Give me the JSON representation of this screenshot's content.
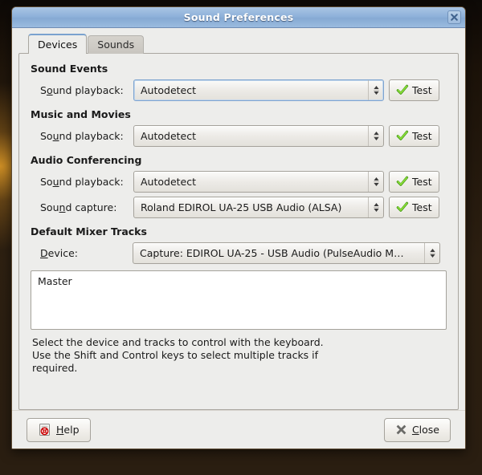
{
  "window": {
    "title": "Sound Preferences",
    "close_icon": "close-icon"
  },
  "tabs": [
    {
      "label": "Devices",
      "active": true
    },
    {
      "label": "Sounds",
      "active": false
    }
  ],
  "groups": [
    {
      "title": "Sound Events",
      "rows": [
        {
          "label_before": "S",
          "label_mnemonic": "o",
          "label_after": "und playback:",
          "value": "Autodetect",
          "button": "Test",
          "button_icon": "check-icon",
          "focused": true
        }
      ]
    },
    {
      "title": "Music and Movies",
      "rows": [
        {
          "label_before": "So",
          "label_mnemonic": "u",
          "label_after": "nd playback:",
          "value": "Autodetect",
          "button": "Test",
          "button_icon": "check-icon",
          "focused": false
        }
      ]
    },
    {
      "title": "Audio Conferencing",
      "rows": [
        {
          "label_before": "So",
          "label_mnemonic": "u",
          "label_after": "nd playback:",
          "value": "Autodetect",
          "button": "Test",
          "button_icon": "check-icon",
          "focused": false
        },
        {
          "label_before": "Sou",
          "label_mnemonic": "n",
          "label_after": "d capture:",
          "value": "Roland EDIROL UA-25 USB Audio (ALSA)",
          "button": "Test",
          "button_icon": "check-icon",
          "focused": false
        }
      ]
    }
  ],
  "mixer": {
    "title": "Default Mixer Tracks",
    "device_label_before": "",
    "device_label_mnemonic": "D",
    "device_label_after": "evice:",
    "device_value": "Capture: EDIROL UA-25 - USB Audio (PulseAudio M…",
    "tracks": [
      "Master"
    ],
    "hint_line1": "Select the device and tracks to control with the keyboard.",
    "hint_line2": "Use the Shift and Control keys to select multiple tracks if",
    "hint_line3": "required."
  },
  "actions": {
    "help_before": "",
    "help_mnemonic": "H",
    "help_after": "elp",
    "help_icon": "help-document-icon",
    "close_before": "",
    "close_mnemonic": "C",
    "close_after": "lose",
    "close_icon": "close-x-icon"
  },
  "colors": {
    "titlebar_blue": "#8fb2da",
    "dialog_bg": "#ededeb",
    "check_green": "#73d216",
    "desktop_brown": "#2c1f11"
  }
}
